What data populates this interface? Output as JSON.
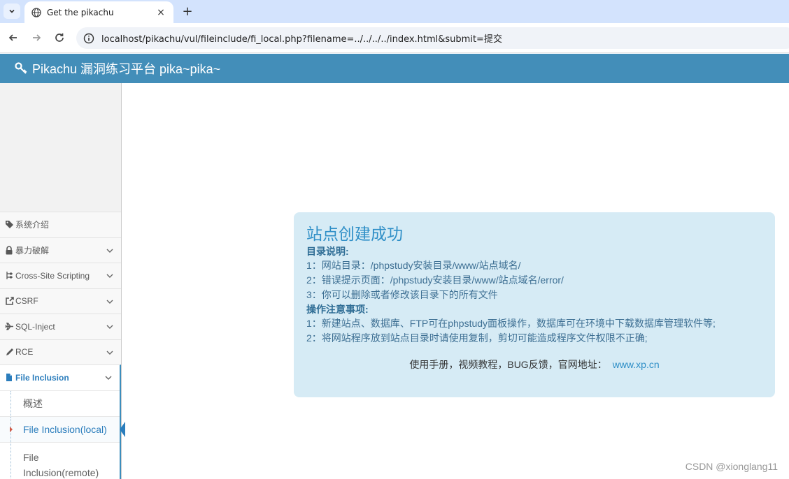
{
  "browser": {
    "tab_title": "Get the pikachu",
    "close_glyph": "×",
    "new_tab_glyph": "+",
    "url": "localhost/pikachu/vul/fileinclude/fi_local.php?filename=../../../../index.html&submit=提交"
  },
  "header": {
    "title": "Pikachu 漏洞练习平台 pika~pika~",
    "color": "#438eb9"
  },
  "sidebar": {
    "items": [
      {
        "label": "系统介绍",
        "icon": "tag-icon"
      },
      {
        "label": "暴力破解",
        "icon": "lock-icon"
      },
      {
        "label": "Cross-Site Scripting",
        "icon": "sitemap-icon"
      },
      {
        "label": "CSRF",
        "icon": "external-link-icon"
      },
      {
        "label": "SQL-Inject",
        "icon": "plane-icon"
      },
      {
        "label": "RCE",
        "icon": "pencil-icon"
      },
      {
        "label": "File Inclusion",
        "icon": "file-icon"
      }
    ],
    "submenu": [
      {
        "label": "概述"
      },
      {
        "label": "File Inclusion(local)"
      },
      {
        "label": "File Inclusion(remote)"
      }
    ]
  },
  "content": {
    "title": "站点创建成功",
    "dir_heading": "目录说明:",
    "dir_lines": [
      "1：网站目录：/phpstudy安装目录/www/站点域名/",
      "2：错误提示页面：/phpstudy安装目录/www/站点域名/error/",
      "3：你可以删除或者修改该目录下的所有文件"
    ],
    "ops_heading": "操作注意事项:",
    "ops_lines": [
      "1：新建站点、数据库、FTP可在phpstudy面板操作，数据库可在环境中下载数据库管理软件等;",
      "2：将网站程序放到站点目录时请使用复制，剪切可能造成程序文件权限不正确;"
    ],
    "footer_text": "使用手册，视频教程，BUG反馈，官网地址：",
    "footer_link": "www.xp.cn"
  },
  "watermark": "CSDN @xionglang11"
}
